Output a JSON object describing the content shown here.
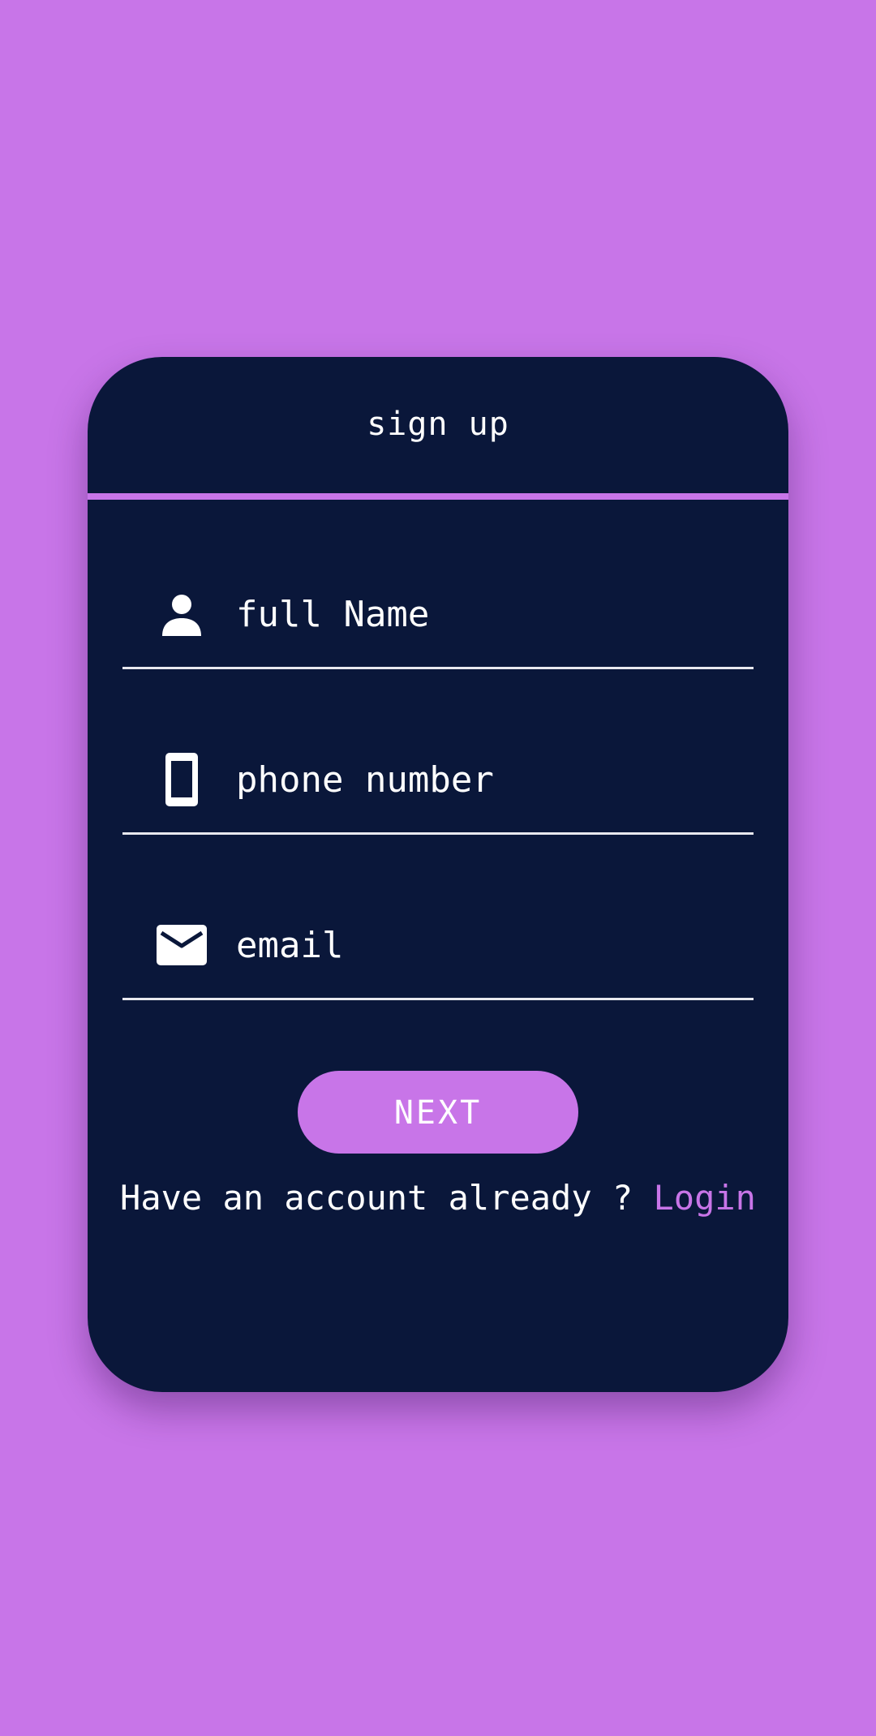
{
  "header": {
    "title": "sign up"
  },
  "form": {
    "full_name": {
      "placeholder": "full Name",
      "icon": "person-icon"
    },
    "phone": {
      "placeholder": "phone number",
      "icon": "phone-icon"
    },
    "email": {
      "placeholder": "email",
      "icon": "mail-icon"
    }
  },
  "next_button": {
    "label": "NEXT"
  },
  "footer": {
    "prompt": "Have an account already ? ",
    "login_label": "Login"
  },
  "colors": {
    "background": "#c875e8",
    "card": "#0a173a",
    "accent": "#c875e8",
    "text": "#ffffff"
  }
}
